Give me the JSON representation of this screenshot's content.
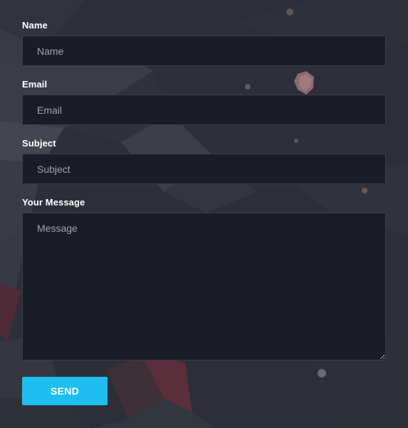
{
  "form": {
    "name": {
      "label": "Name",
      "placeholder": "Name"
    },
    "email": {
      "label": "Email",
      "placeholder": "Email"
    },
    "subject": {
      "label": "Subject",
      "placeholder": "Subject"
    },
    "message": {
      "label": "Your Message",
      "placeholder": "Message"
    },
    "send_label": "SEND"
  },
  "colors": {
    "accent": "#1fbef1",
    "input_background": "#1b1d26",
    "page_background": "#2a2d36",
    "label_text": "#ffffff"
  }
}
